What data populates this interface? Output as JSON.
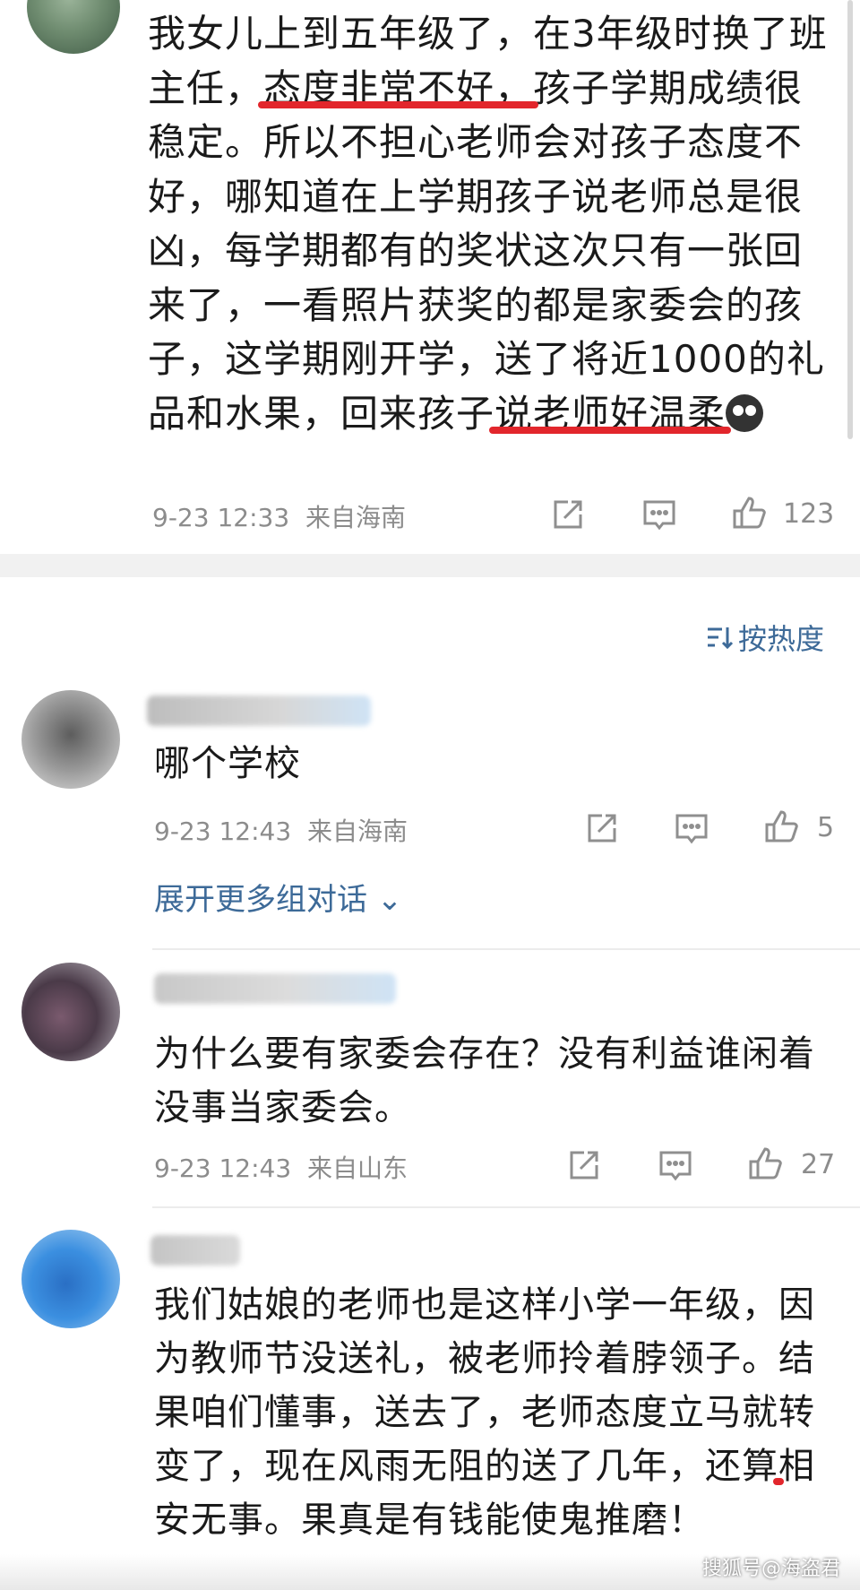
{
  "post": {
    "text_parts": [
      "我女儿上到五年级了，在3年级时换了班主任，",
      "态度非常不好，",
      "孩子学期成绩很稳定。所以不担心老师会对孩子态度不好，哪知道在上学期孩子说老师总是很凶，每学期都有的奖状这次只有一张回来了，一看照片获奖的都是家委会的孩子，这学期刚开学，",
      "送了将近1000的礼品和水果，回来孩子说老师好温柔"
    ],
    "emoji": "sob-emoji",
    "time": "9-23 12:33",
    "source": "来自海南",
    "likes": "123"
  },
  "sort": {
    "label": "按热度"
  },
  "comments": [
    {
      "text": "哪个学校",
      "time": "9-23 12:43",
      "source": "来自海南",
      "likes": "5",
      "expand": "展开更多组对话"
    },
    {
      "text": "为什么要有家委会存在？没有利益谁闲着没事当家委会。",
      "time": "9-23 12:43",
      "source": "来自山东",
      "likes": "27"
    },
    {
      "text_parts": [
        "我们姑娘的老师也是这样小学一年级，因为教师节没送礼，被老师拎着脖领子。",
        "结果咱们懂事，送去了，老师态度立马就转变了",
        "，现在风雨无阻的送了几年，还算相安无事。果真是有钱能使鬼推磨！"
      ]
    }
  ],
  "watermark": "搜狐号@海盗君",
  "colors": {
    "underline": "#e2262c",
    "link": "#3d6a98",
    "meta": "#8c8c8c"
  }
}
